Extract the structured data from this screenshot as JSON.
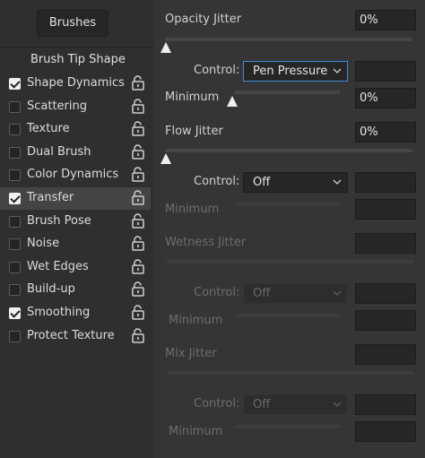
{
  "left": {
    "brushes_button": "Brushes",
    "brush_tip_shape": "Brush Tip Shape",
    "options": [
      {
        "label": "Shape Dynamics",
        "checked": true
      },
      {
        "label": "Scattering",
        "checked": false
      },
      {
        "label": "Texture",
        "checked": false
      },
      {
        "label": "Dual Brush",
        "checked": false
      },
      {
        "label": "Color Dynamics",
        "checked": false
      },
      {
        "label": "Transfer",
        "checked": true,
        "selected": true
      },
      {
        "label": "Brush Pose",
        "checked": false
      },
      {
        "label": "Noise",
        "checked": false
      },
      {
        "label": "Wet Edges",
        "checked": false
      },
      {
        "label": "Build-up",
        "checked": false
      },
      {
        "label": "Smoothing",
        "checked": true
      },
      {
        "label": "Protect Texture",
        "checked": false
      }
    ]
  },
  "right": {
    "opacity_jitter": {
      "label": "Opacity Jitter",
      "value": "0%",
      "slider_fraction": 0
    },
    "opacity_control": {
      "label": "Control:",
      "selected": "Pen Pressure",
      "value": ""
    },
    "opacity_minimum": {
      "label": "Minimum",
      "value": "0%",
      "slider_fraction": 0
    },
    "flow_jitter": {
      "label": "Flow Jitter",
      "value": "0%",
      "slider_fraction": 0
    },
    "flow_control": {
      "label": "Control:",
      "selected": "Off",
      "value": ""
    },
    "flow_minimum": {
      "label": "Minimum",
      "value": ""
    },
    "wetness_jitter": {
      "label": "Wetness Jitter",
      "value": ""
    },
    "wetness_control": {
      "label": "Control:",
      "selected": "Off",
      "value": ""
    },
    "wetness_minimum": {
      "label": "Minimum",
      "value": ""
    },
    "mix_jitter": {
      "label": "Mix Jitter",
      "value": ""
    },
    "mix_control": {
      "label": "Control:",
      "selected": "Off",
      "value": ""
    },
    "mix_minimum": {
      "label": "Minimum",
      "value": ""
    }
  },
  "colors": {
    "focus": "#3e8ad8",
    "selected_row": "#444444",
    "panel": "#353535"
  },
  "icons": {
    "lock": "lock-open-icon",
    "check": "checkmark-icon",
    "chevron": "chevron-down-icon",
    "thumb": "slider-triangle-icon"
  }
}
